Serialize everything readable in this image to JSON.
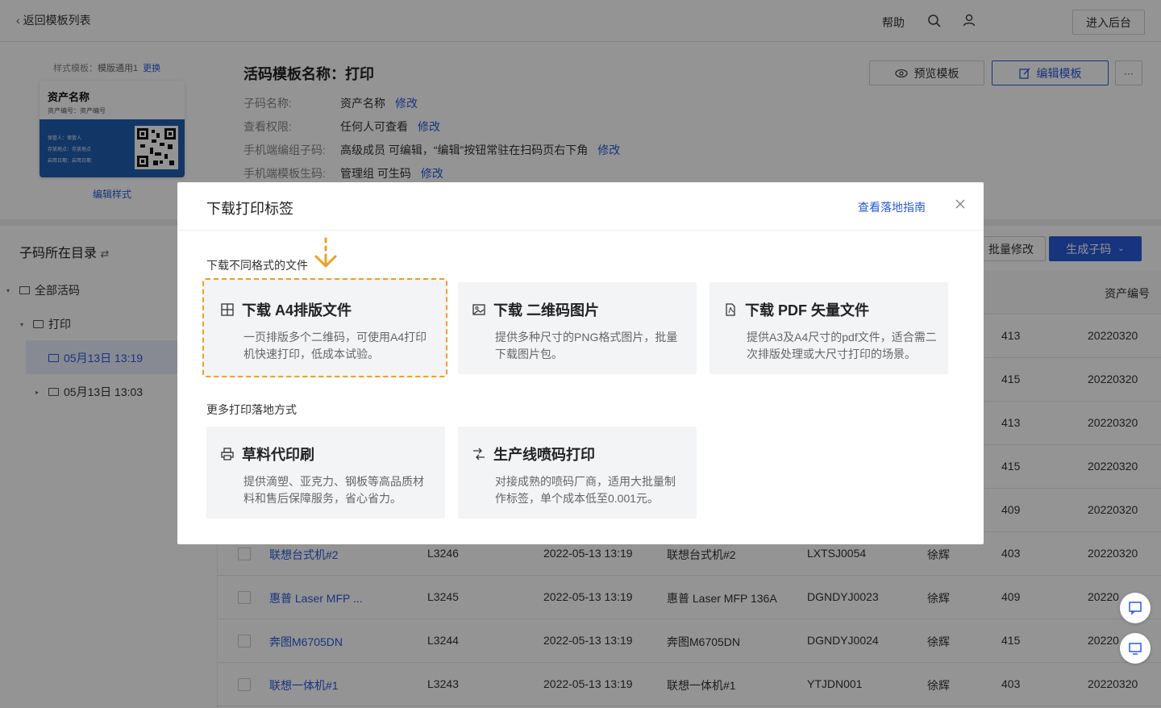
{
  "topbar": {
    "back_label": "返回模板列表",
    "help": "帮助",
    "enter_admin": "进入后台"
  },
  "template": {
    "style_label": "样式模板：",
    "style_value": "模版通用1",
    "change_link": "更换",
    "card_title": "资产名称",
    "card_subtitle": "资产编号：资产编号",
    "card_lines": [
      "保管人：保管人",
      "存放地点：存放地点",
      "启用日期：启用日期"
    ],
    "edit_style": "编辑样式",
    "title": "活码模板名称：打印",
    "info": [
      {
        "key": "子码名称:",
        "value": "资产名称",
        "modify": "修改"
      },
      {
        "key": "查看权限:",
        "value": "任何人可查看",
        "modify": "修改"
      },
      {
        "key": "手机端编组子码:",
        "value": "高级成员 可编辑，“编辑”按钮常驻在扫码页右下角",
        "modify": "修改"
      },
      {
        "key": "手机端模板生码:",
        "value": "管理组 可生码",
        "modify": "修改"
      }
    ],
    "preview_btn": "预览模板",
    "edit_btn": "编辑模板",
    "more_btn": "···"
  },
  "sidebar": {
    "title": "子码所在目录",
    "all": "全部活码",
    "print": "打印",
    "folder_selected": "05月13日 13:19",
    "folder_other": "05月13日 13:03"
  },
  "main": {
    "batch_btn": "批量修改",
    "gen_btn": "生成子码",
    "col_asset": "资产编号",
    "rows": [
      {
        "name": "",
        "code": "",
        "time": "",
        "model": "",
        "asset": "",
        "owner": "",
        "num": "413",
        "date": "20220320"
      },
      {
        "name": "",
        "code": "",
        "time": "",
        "model": "",
        "asset": "",
        "owner": "",
        "num": "415",
        "date": "20220320"
      },
      {
        "name": "",
        "code": "",
        "time": "",
        "model": "",
        "asset": "",
        "owner": "",
        "num": "413",
        "date": "20220320"
      },
      {
        "name": "",
        "code": "",
        "time": "",
        "model": "",
        "asset": "",
        "owner": "",
        "num": "415",
        "date": "20220320"
      },
      {
        "name": "",
        "code": "",
        "time": "",
        "model": "",
        "asset": "",
        "owner": "",
        "num": "409",
        "date": "20220320"
      },
      {
        "name": "联想台式机#2",
        "code": "L3246",
        "time": "2022-05-13 13:19",
        "model": "联想台式机#2",
        "asset": "LXTSJ0054",
        "owner": "徐辉",
        "num": "403",
        "date": "20220320"
      },
      {
        "name": "惠普 Laser MFP ...",
        "code": "L3245",
        "time": "2022-05-13 13:19",
        "model": "惠普 Laser MFP 136A",
        "asset": "DGNDYJ0023",
        "owner": "徐辉",
        "num": "409",
        "date": "20220"
      },
      {
        "name": "奔图M6705DN",
        "code": "L3244",
        "time": "2022-05-13 13:19",
        "model": "奔图M6705DN",
        "asset": "DGNDYJ0024",
        "owner": "徐辉",
        "num": "415",
        "date": "20220"
      },
      {
        "name": "联想一体机#1",
        "code": "L3243",
        "time": "2022-05-13 13:19",
        "model": "联想一体机#1",
        "asset": "YTJDN001",
        "owner": "徐辉",
        "num": "403",
        "date": "20220320"
      }
    ]
  },
  "modal": {
    "title": "下载打印标签",
    "guide_link": "查看落地指南",
    "section1": "下载不同格式的文件",
    "section2": "更多打印落地方式",
    "options": [
      {
        "title": "下载 A4排版文件",
        "desc": "一页排版多个二维码，可使用A4打印机快速打印，低成本试验。"
      },
      {
        "title": "下载 二维码图片",
        "desc": "提供多种尺寸的PNG格式图片，批量下载图片包。"
      },
      {
        "title": "下载 PDF 矢量文件",
        "desc": "提供A3及A4尺寸的pdf文件，适合需二次排版处理或大尺寸打印的场景。"
      },
      {
        "title": "草料代印刷",
        "desc": "提供滴塑、亚克力、钢板等高品质材料和售后保障服务，省心省力。"
      },
      {
        "title": "生产线喷码打印",
        "desc": "对接成熟的喷码厂商，适用大批量制作标签，单个成本低至0.001元。"
      }
    ]
  },
  "colors": {
    "accent": "#2a5ad9",
    "highlight": "#f0a020",
    "overlay": "rgba(0,0,0,0.42)"
  }
}
